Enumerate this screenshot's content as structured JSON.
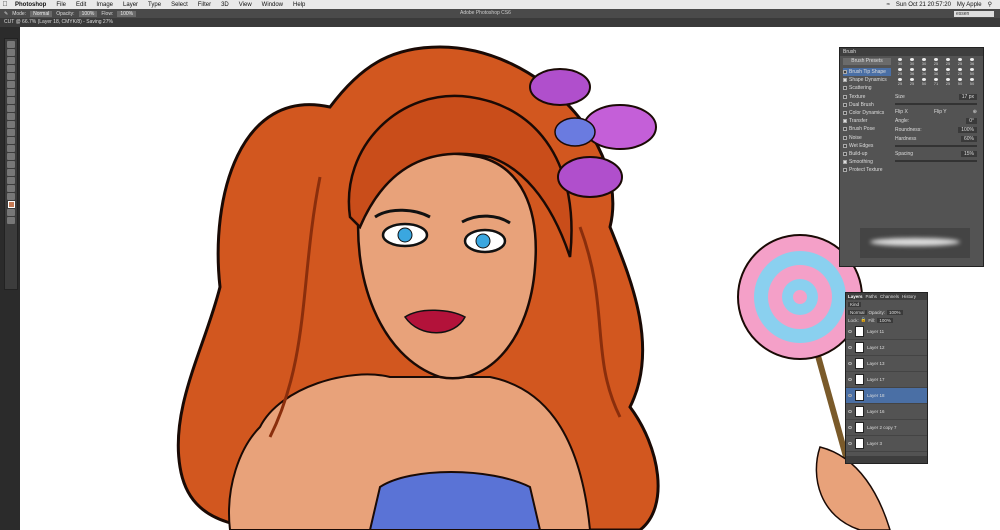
{
  "menubar": {
    "apple": "",
    "items": [
      "Photoshop",
      "File",
      "Edit",
      "Image",
      "Layer",
      "Type",
      "Select",
      "Filter",
      "3D",
      "View",
      "Window",
      "Help"
    ],
    "clock": "Sun Oct 21  20:57:20",
    "user": "My Apple"
  },
  "app_title": "Adobe Photoshop CS6",
  "options": {
    "mode_label": "Mode:",
    "mode_value": "Normal",
    "opacity_label": "Opacity:",
    "opacity_value": "100%",
    "flow_label": "Flow:",
    "flow_value": "100%",
    "workspace": "essen"
  },
  "document_tab": "CUT @ 66.7% (Layer 18, CMYK/8) - Saving 27%",
  "brush_panel": {
    "title": "Brush",
    "presets_button": "Brush Presets",
    "items": [
      {
        "label": "Brush Tip Shape",
        "checked": false,
        "selected": true
      },
      {
        "label": "Shape Dynamics",
        "checked": true
      },
      {
        "label": "Scattering",
        "checked": false
      },
      {
        "label": "Texture",
        "checked": false
      },
      {
        "label": "Dual Brush",
        "checked": false
      },
      {
        "label": "Color Dynamics",
        "checked": false
      },
      {
        "label": "Transfer",
        "checked": true
      },
      {
        "label": "Brush Pose",
        "checked": false
      },
      {
        "label": "Noise",
        "checked": false
      },
      {
        "label": "Wet Edges",
        "checked": false
      },
      {
        "label": "Build-up",
        "checked": false
      },
      {
        "label": "Smoothing",
        "checked": true
      },
      {
        "label": "Protect Texture",
        "checked": false
      }
    ],
    "tip_sizes": [
      "30",
      "30",
      "30",
      "25",
      "25",
      "25",
      "36",
      "25",
      "36",
      "36",
      "36",
      "32",
      "25",
      "50",
      "25",
      "25",
      "50",
      "71",
      "25",
      "50",
      "50"
    ],
    "size_label": "Size",
    "size_value": "17 px",
    "flip_x": "Flip X",
    "flip_y": "Flip Y",
    "angle_label": "Angle:",
    "angle_value": "0°",
    "roundness_label": "Roundness:",
    "roundness_value": "100%",
    "hardness_label": "Hardness",
    "hardness_value": "60%",
    "spacing_label": "Spacing",
    "spacing_value": "15%"
  },
  "layers_panel": {
    "tabs": [
      "Layers",
      "Paths",
      "Channels",
      "History"
    ],
    "kind": "Kind",
    "blend": "Normal",
    "opacity_label": "Opacity:",
    "opacity_value": "100%",
    "lock_label": "Lock:",
    "fill_label": "Fill:",
    "fill_value": "100%",
    "layers": [
      {
        "name": "Layer 11",
        "selected": false
      },
      {
        "name": "Layer 12",
        "selected": false
      },
      {
        "name": "Layer 13",
        "selected": false
      },
      {
        "name": "Layer 17",
        "selected": false
      },
      {
        "name": "Layer 18",
        "selected": true
      },
      {
        "name": "Layer 16",
        "selected": false
      },
      {
        "name": "Layer 2 copy 7",
        "selected": false
      },
      {
        "name": "Layer 3",
        "selected": false
      }
    ]
  },
  "colors": {
    "hair": "#d2571f",
    "skin": "#e8a27a",
    "foreground": "#c47a55"
  }
}
